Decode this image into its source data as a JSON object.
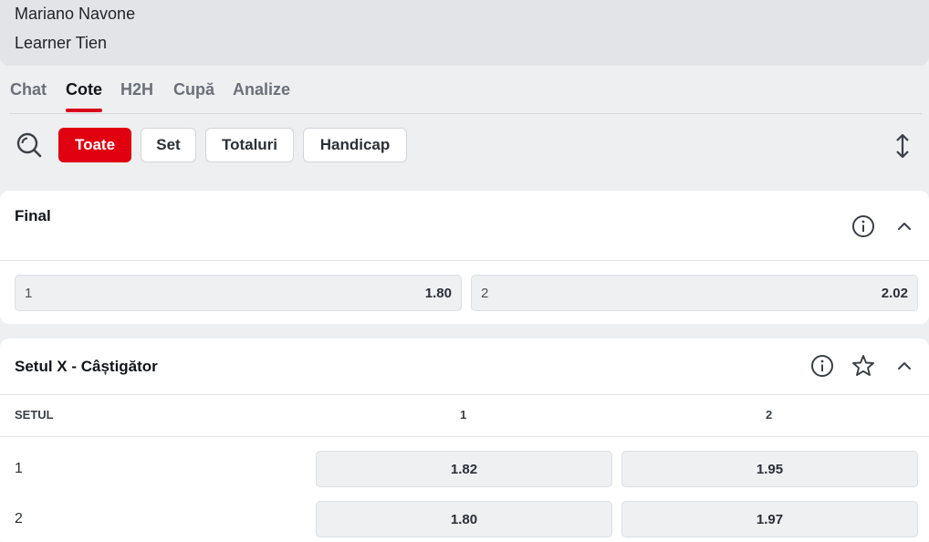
{
  "players": {
    "home": "Mariano Navone",
    "away": "Learner Tien"
  },
  "tabs": [
    {
      "label": "Chat"
    },
    {
      "label": "Cote"
    },
    {
      "label": "H2H"
    },
    {
      "label": "Cupă"
    },
    {
      "label": "Analize"
    }
  ],
  "active_tab": "Cote",
  "filters": [
    {
      "label": "Toate"
    },
    {
      "label": "Set"
    },
    {
      "label": "Totaluri"
    },
    {
      "label": "Handicap"
    }
  ],
  "active_filter": "Toate",
  "colors": {
    "accent": "#e0000f",
    "tab_underline": "#d9001b"
  },
  "icons": {
    "search": "search-icon",
    "sort": "sort-arrows-icon",
    "info": "info-icon",
    "collapse": "chevron-up-icon",
    "favorite": "star-icon"
  },
  "market_final": {
    "title": "Final",
    "outcomes": [
      {
        "label": "1",
        "odd": "1.80"
      },
      {
        "label": "2",
        "odd": "2.02"
      }
    ]
  },
  "market_set_winner": {
    "title": "Setul X - Câștigător",
    "columns": [
      "SETUL",
      "1",
      "2"
    ],
    "rows": [
      {
        "set": "1",
        "odd1": "1.82",
        "odd2": "1.95"
      },
      {
        "set": "2",
        "odd1": "1.80",
        "odd2": "1.97"
      }
    ]
  }
}
